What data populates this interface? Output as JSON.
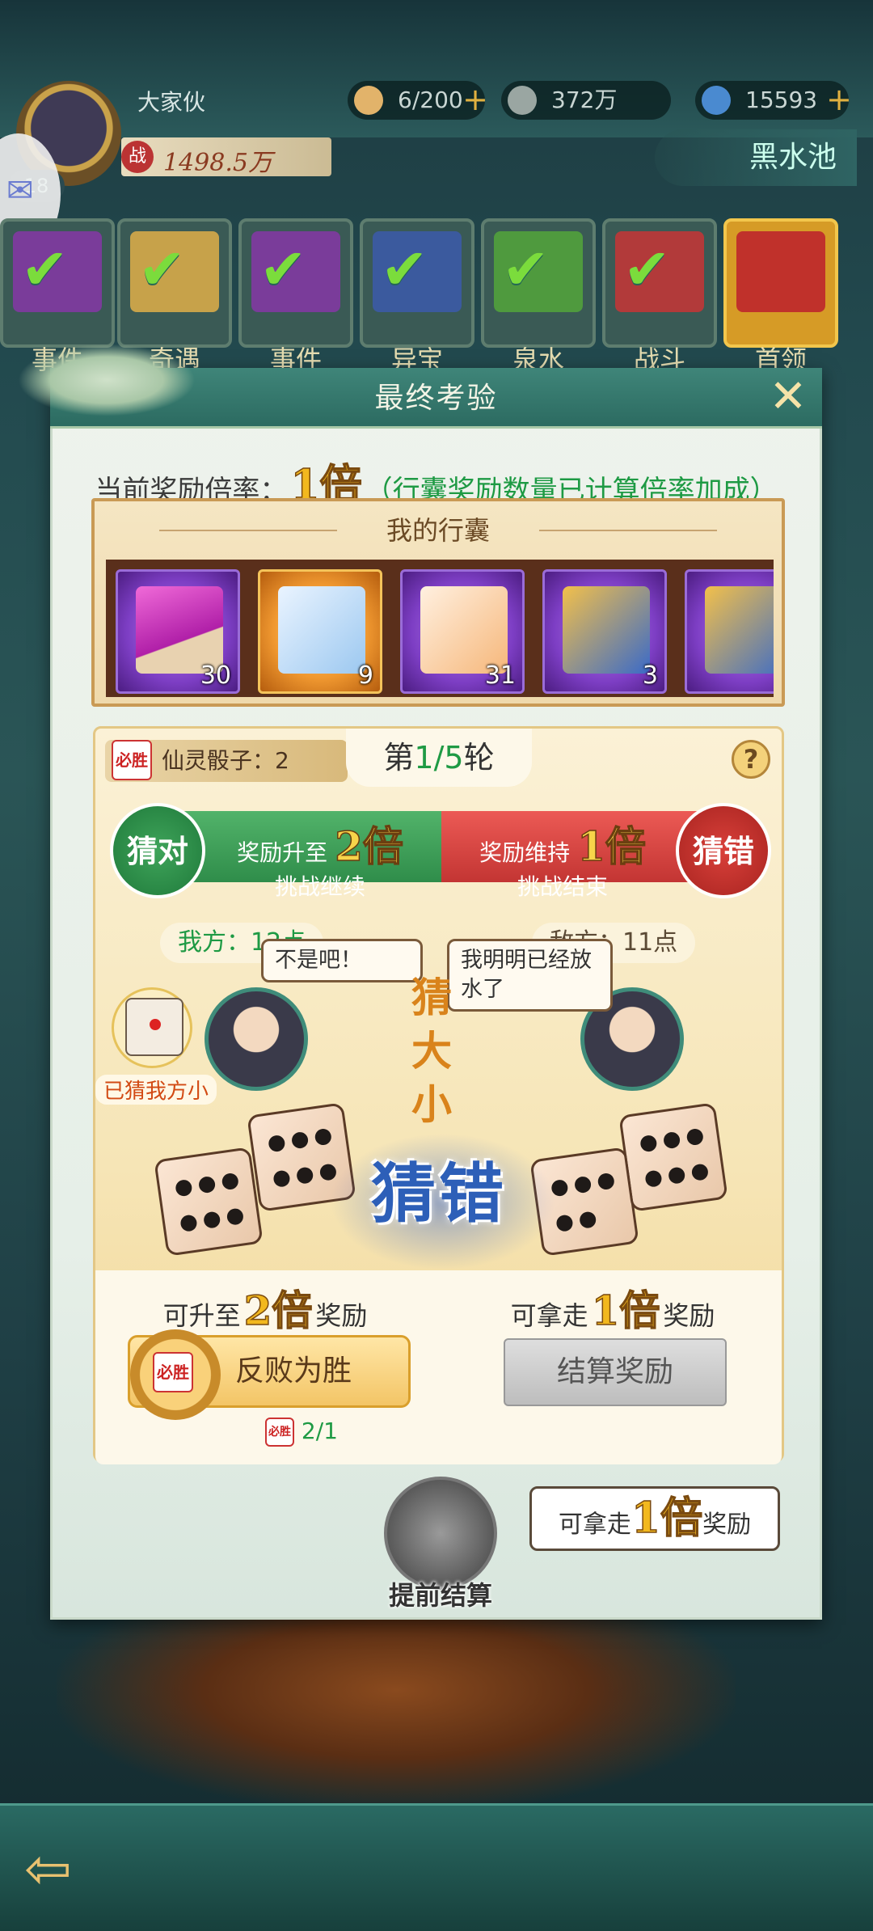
{
  "player": {
    "name": "大家伙",
    "level": "18",
    "power_icon": "战",
    "power": "1498.5万"
  },
  "resources": [
    {
      "icon": "bun-icon",
      "value": "6/200",
      "plus": "+"
    },
    {
      "icon": "coin-icon",
      "value": "372万",
      "plus": ""
    },
    {
      "icon": "spirit-icon",
      "value": "15593",
      "plus": "+"
    }
  ],
  "map_title": "黑水池",
  "tasks": [
    {
      "label": "事件",
      "color": "#7a3c9a"
    },
    {
      "label": "奇遇",
      "color": "#c7a24a"
    },
    {
      "label": "事件",
      "color": "#7a3c9a"
    },
    {
      "label": "异宝",
      "color": "#3b5a9e"
    },
    {
      "label": "泉水",
      "color": "#4f9a3e"
    },
    {
      "label": "战斗",
      "color": "#b23a3a"
    },
    {
      "label": "首领",
      "color": "#c0312b"
    }
  ],
  "modal": {
    "title": "最终考验",
    "close": "✕",
    "multiplier": {
      "prefix": "当前奖励倍率：",
      "value": "1倍",
      "note": "（行囊奖励数量已计算倍率加成）"
    },
    "bag": {
      "title": "我的行囊",
      "items": [
        {
          "count": "30",
          "rarity": "purple"
        },
        {
          "count": "9",
          "rarity": "orange"
        },
        {
          "count": "31",
          "rarity": "purple"
        },
        {
          "count": "3",
          "rarity": "purple"
        },
        {
          "count": "",
          "rarity": "purple"
        }
      ]
    },
    "game": {
      "dice_label": "仙灵骰子：2",
      "dice_icon": "必胜",
      "round_prefix": "第",
      "round_current": "1/5",
      "round_suffix": "轮",
      "help": "?",
      "correct_btn": "猜对",
      "wrong_btn": "猜错",
      "correct_l1_prefix": "奖励升至",
      "correct_l1_big": "2倍",
      "correct_l2": "挑战继续",
      "wrong_l1_prefix": "奖励维持",
      "wrong_l1_big": "1倍",
      "wrong_l2": "挑战结束",
      "my_score": "我方：12点",
      "enemy_score": "敌方：11点",
      "my_speech": "不是吧！",
      "enemy_speech": "我明明已经放水了",
      "guess_title": "猜大小",
      "guessed_label": "已猜我方小",
      "result": "猜错"
    },
    "bottom": {
      "upgrade_prefix": "可升至",
      "upgrade_big": "2倍",
      "upgrade_suffix": "奖励",
      "take_prefix": "可拿走",
      "take_big": "1倍",
      "take_suffix": "奖励",
      "comeback_btn": "反败为胜",
      "settle_btn": "结算奖励",
      "die_ratio": "2/1"
    },
    "early": {
      "label": "提前结算",
      "tip_prefix": "可拿走",
      "tip_big": "1倍",
      "tip_suffix": "奖励"
    }
  }
}
